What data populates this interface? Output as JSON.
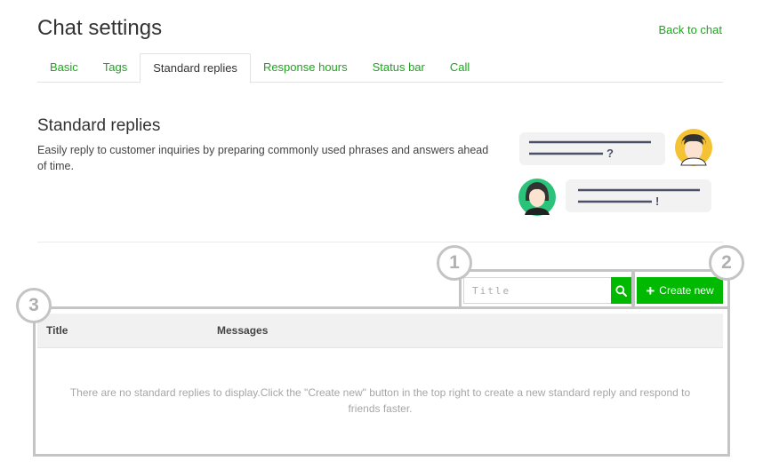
{
  "header": {
    "title": "Chat settings",
    "back_link": "Back to chat"
  },
  "tabs": [
    {
      "label": "Basic",
      "active": false
    },
    {
      "label": "Tags",
      "active": false
    },
    {
      "label": "Standard replies",
      "active": true
    },
    {
      "label": "Response hours",
      "active": false
    },
    {
      "label": "Status bar",
      "active": false
    },
    {
      "label": "Call",
      "active": false
    }
  ],
  "section": {
    "title": "Standard replies",
    "description": "Easily reply to customer inquiries by preparing commonly used phrases and answers ahead of time."
  },
  "illustration": {
    "question_mark": "?",
    "exclamation_mark": "!"
  },
  "search": {
    "placeholder": "Title",
    "value": "",
    "icon": "search-icon"
  },
  "create_button": {
    "label": "Create new",
    "icon": "plus-icon"
  },
  "annotations": [
    "1",
    "2",
    "3"
  ],
  "table": {
    "columns": [
      "Title",
      "Messages"
    ],
    "empty_message": "There are no standard replies to display.Click the \"Create new\" button in the top right to create a new standard reply and respond to friends faster."
  },
  "colors": {
    "accent": "#00b900",
    "link": "#1ea41e",
    "annotation": "#c4c4c4"
  }
}
